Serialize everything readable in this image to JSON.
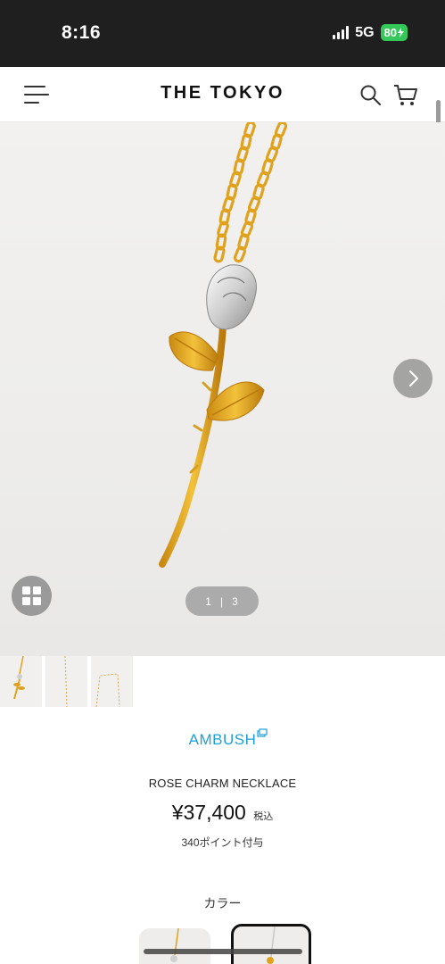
{
  "status_bar": {
    "time": "8:16",
    "network": "5G",
    "battery": "80"
  },
  "header": {
    "title": "THE TOKYO",
    "icons": [
      "menu-icon",
      "search-icon",
      "cart-icon"
    ]
  },
  "gallery": {
    "current": "1",
    "total": "3",
    "icons": [
      "grid-icon",
      "chevron-right-icon"
    ]
  },
  "product": {
    "brand": "AMBUSH",
    "name": "ROSE CHARM NECKLACE",
    "price": "¥37,400",
    "tax_label": "税込",
    "points": "340ポイント付与",
    "color_label": "カラー"
  },
  "colors": {
    "accent_brand": "#1fa0d6",
    "gold": "#e0a21d",
    "battery": "#34c759"
  }
}
